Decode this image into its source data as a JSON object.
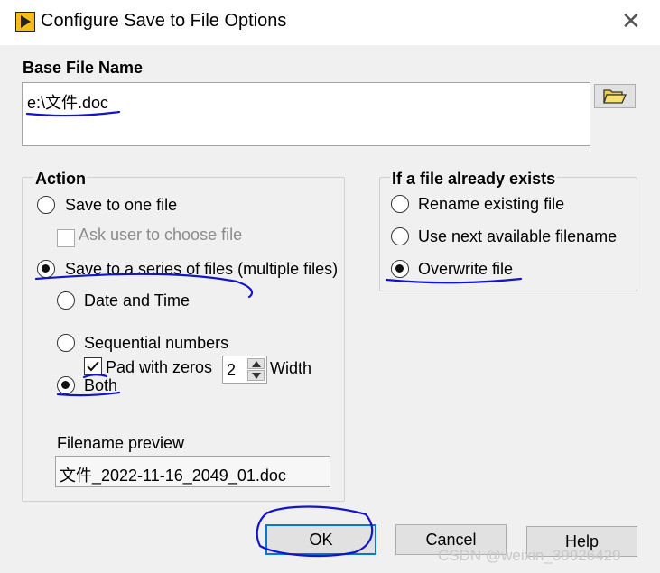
{
  "window": {
    "title": "Configure Save to File Options",
    "close_symbol": "✕",
    "icon": "labview-run-icon"
  },
  "base_file_name": {
    "label": "Base File Name",
    "value": "e:\\文件.doc",
    "browse_icon": "folder-open-icon"
  },
  "action": {
    "label": "Action",
    "save_one_file": "Save to one file",
    "ask_user": "Ask user to choose file",
    "save_series": "Save to a series of files (multiple files)",
    "date_time": "Date and Time",
    "sequential": "Sequential numbers",
    "pad_zeros": "Pad with zeros",
    "width_value": "2",
    "width_label": "Width",
    "both": "Both",
    "selected": "save_series",
    "series_mode": "both",
    "pad_zeros_checked": true,
    "ask_user_checked": false,
    "filename_preview_label": "Filename preview",
    "filename_preview_value": "文件_2022-11-16_2049_01.doc"
  },
  "if_exists": {
    "label": "If a file already exists",
    "rename": "Rename existing file",
    "next_available": "Use next available filename",
    "overwrite": "Overwrite file",
    "selected": "overwrite"
  },
  "buttons": {
    "ok": "OK",
    "cancel": "Cancel",
    "help": "Help"
  },
  "watermark": "CSDN @weixin_39926429",
  "colors": {
    "annotation_ink": "#1414c8",
    "ok_border": "#0078d7",
    "app_icon": "#f3bd1b"
  }
}
